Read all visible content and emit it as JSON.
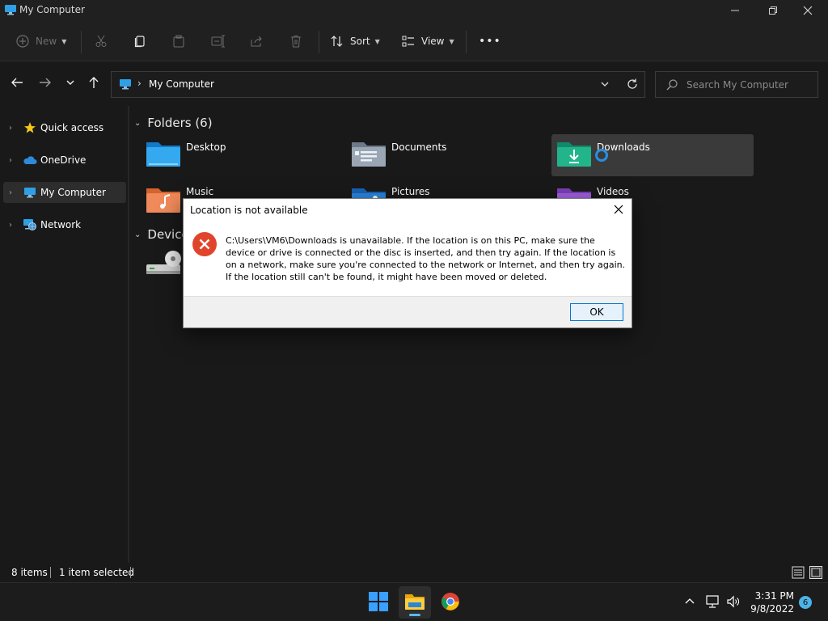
{
  "window": {
    "title": "My Computer",
    "icon": "computer-icon",
    "controls": [
      "minimize-icon",
      "maximize-icon",
      "close-icon"
    ]
  },
  "toolbar": {
    "new_label": "New",
    "sort_label": "Sort",
    "view_label": "View",
    "more_label": "•••",
    "icons": [
      "new-icon",
      "cut-icon",
      "copy-icon",
      "paste-icon",
      "rename-icon",
      "share-icon",
      "delete-icon",
      "sort-icon",
      "view-icon",
      "more-icon"
    ]
  },
  "address": {
    "path": "My Computer",
    "search_placeholder": "Search My Computer"
  },
  "nav": {
    "items": [
      {
        "label": "Quick access",
        "icon": "star-icon"
      },
      {
        "label": "OneDrive",
        "icon": "cloud-icon"
      },
      {
        "label": "My Computer",
        "icon": "computer-icon",
        "selected": true
      },
      {
        "label": "Network",
        "icon": "network-icon"
      }
    ]
  },
  "main": {
    "folders_header": "Folders (6)",
    "devices_header": "Device",
    "folders": [
      {
        "name": "Desktop",
        "icon": "desktop-folder-icon"
      },
      {
        "name": "Documents",
        "icon": "documents-folder-icon"
      },
      {
        "name": "Downloads",
        "icon": "downloads-folder-icon",
        "selected": true
      },
      {
        "name": "Music",
        "icon": "music-folder-icon"
      },
      {
        "name": "Pictures",
        "icon": "pictures-folder-icon"
      },
      {
        "name": "Videos",
        "icon": "videos-folder-icon"
      }
    ],
    "device_icon": "dvd-drive-icon"
  },
  "status": {
    "item_count": "8 items",
    "selection": "1 item selected"
  },
  "dialog": {
    "title": "Location is not available",
    "message": "C:\\Users\\VM6\\Downloads is unavailable. If the location is on this PC, make sure the device or drive is connected or the disc is inserted, and then try again. If the location is on a network, make sure you're connected to the network or Internet, and then try again. If the location still can't be found, it might have been moved or deleted.",
    "ok_label": "OK",
    "icon": "error-icon"
  },
  "taskbar": {
    "apps": [
      "start-icon",
      "file-explorer-icon",
      "chrome-icon"
    ],
    "time": "3:31 PM",
    "date": "9/8/2022",
    "notification_count": "6"
  },
  "colors": {
    "background": "#191919",
    "accent": "#0078d4",
    "error": "#e0452b"
  }
}
